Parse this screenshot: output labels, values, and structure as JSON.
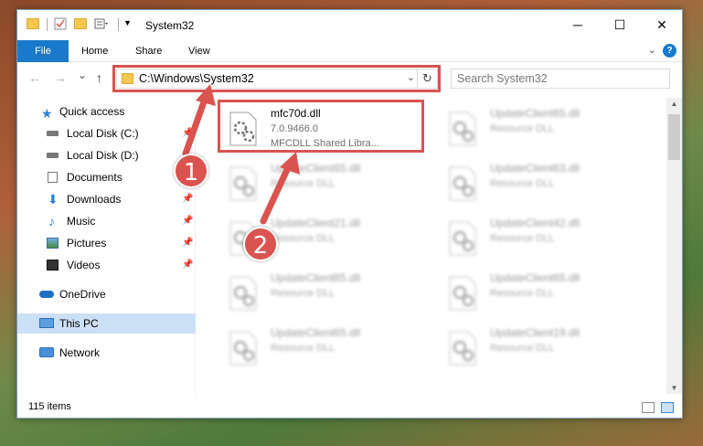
{
  "window": {
    "title": "System32",
    "controls": {
      "minimize": "─",
      "maximize": "☐",
      "close": "✕"
    }
  },
  "ribbon": {
    "file": "File",
    "tabs": [
      "Home",
      "Share",
      "View"
    ],
    "help": "?"
  },
  "nav": {
    "back": "←",
    "forward": "→",
    "recent": "⌄",
    "up": "↑",
    "address": "C:\\Windows\\System32",
    "refresh": "↻",
    "search_placeholder": "Search System32"
  },
  "sidebar": {
    "items": [
      {
        "label": "Quick access",
        "icon": "star-icon",
        "pinned": false
      },
      {
        "label": "Local Disk (C:)",
        "icon": "drive-icon",
        "pinned": true
      },
      {
        "label": "Local Disk (D:)",
        "icon": "drive-icon",
        "pinned": false
      },
      {
        "label": "Documents",
        "icon": "documents-icon",
        "pinned": true
      },
      {
        "label": "Downloads",
        "icon": "download-icon",
        "pinned": true
      },
      {
        "label": "Music",
        "icon": "music-icon",
        "pinned": true
      },
      {
        "label": "Pictures",
        "icon": "pictures-icon",
        "pinned": true
      },
      {
        "label": "Videos",
        "icon": "videos-icon",
        "pinned": true
      },
      {
        "label": "OneDrive",
        "icon": "cloud-icon",
        "pinned": false
      },
      {
        "label": "This PC",
        "icon": "computer-icon",
        "pinned": false,
        "selected": true
      },
      {
        "label": "Network",
        "icon": "network-icon",
        "pinned": false
      }
    ]
  },
  "files": [
    {
      "name": "mfc70d.dll",
      "line2": "7.0.9466.0",
      "line3": "MFCDLL Shared Libra...",
      "highlighted": true
    },
    {
      "name": "UpdateClient65.dll",
      "line2": "Resource DLL",
      "line3": ""
    },
    {
      "name": "UpdateClient65.dll",
      "line2": "Resource DLL",
      "line3": ""
    },
    {
      "name": "UpdateClient63.dll",
      "line2": "Resource DLL",
      "line3": ""
    },
    {
      "name": "UpdateClient21.dll",
      "line2": "Resource DLL",
      "line3": ""
    },
    {
      "name": "UpdateClient42.dll",
      "line2": "Resource DLL",
      "line3": ""
    },
    {
      "name": "UpdateClient65.dll",
      "line2": "Resource DLL",
      "line3": ""
    },
    {
      "name": "UpdateClient65.dll",
      "line2": "Resource DLL",
      "line3": ""
    },
    {
      "name": "UpdateClient65.dll",
      "line2": "Resource DLL",
      "line3": ""
    },
    {
      "name": "UpdateClient19.dll",
      "line2": "Resource DLL",
      "line3": ""
    }
  ],
  "status": {
    "items": "115 items"
  },
  "annotations": {
    "step1": "1",
    "step2": "2"
  },
  "colors": {
    "accent": "#1979ca",
    "highlight": "#d9534f",
    "selected": "#cce0f5"
  }
}
